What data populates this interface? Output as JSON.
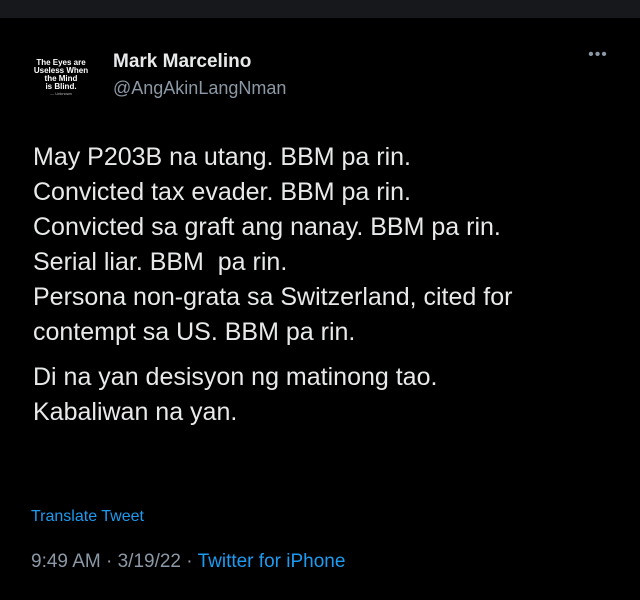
{
  "author": {
    "display_name": "Mark Marcelino",
    "handle": "@AngAkinLangNman",
    "avatar_text": [
      "The Eyes are",
      "Useless When",
      "the Mind",
      "is Blind."
    ],
    "avatar_signature": "— Unknown"
  },
  "more_icon": "•••",
  "tweet": {
    "lines": [
      "May P203B na utang. BBM pa rin.",
      "Convicted tax evader. BBM pa rin.",
      "Convicted sa graft ang nanay. BBM pa rin.",
      "Serial liar. BBM  pa rin.",
      "Persona non-grata sa Switzerland, cited for",
      "contempt sa US. BBM pa rin."
    ],
    "closing_lines": [
      "Di na yan desisyon ng matinong tao.",
      "Kabaliwan na yan."
    ]
  },
  "translate_label": "Translate Tweet",
  "meta": {
    "time": "9:49 AM",
    "separator": " · ",
    "date": "3/19/22",
    "source": "Twitter for iPhone"
  },
  "colors": {
    "background": "#000000",
    "text": "#e7e9ea",
    "secondary": "#8b98a5",
    "accent": "#1d9bf0"
  }
}
